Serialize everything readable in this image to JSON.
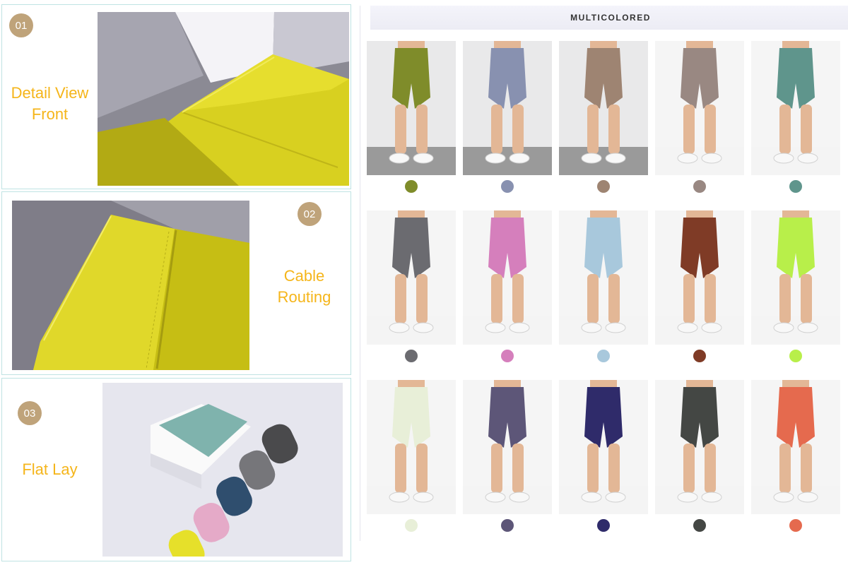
{
  "panels": [
    {
      "number": "01",
      "caption_line1": "Detail View",
      "caption_line2": "Front"
    },
    {
      "number": "02",
      "caption_line1": "Cable",
      "caption_line2": "Routing"
    },
    {
      "number": "03",
      "caption_line1": "Flat Lay",
      "caption_line2": ""
    }
  ],
  "catalog": {
    "title": "MULTICOLORED",
    "items": [
      {
        "color": "#7f8c2a"
      },
      {
        "color": "#8891b0"
      },
      {
        "color": "#9e8472"
      },
      {
        "color": "#998882"
      },
      {
        "color": "#5f958c"
      },
      {
        "color": "#6b6b70"
      },
      {
        "color": "#d57fbc"
      },
      {
        "color": "#a8c8dc"
      },
      {
        "color": "#7f3b26"
      },
      {
        "color": "#b8ef4a"
      },
      {
        "color": "#e8efd8"
      },
      {
        "color": "#5d5678"
      },
      {
        "color": "#2f2b6a"
      },
      {
        "color": "#444744"
      },
      {
        "color": "#e56a4e"
      }
    ]
  }
}
